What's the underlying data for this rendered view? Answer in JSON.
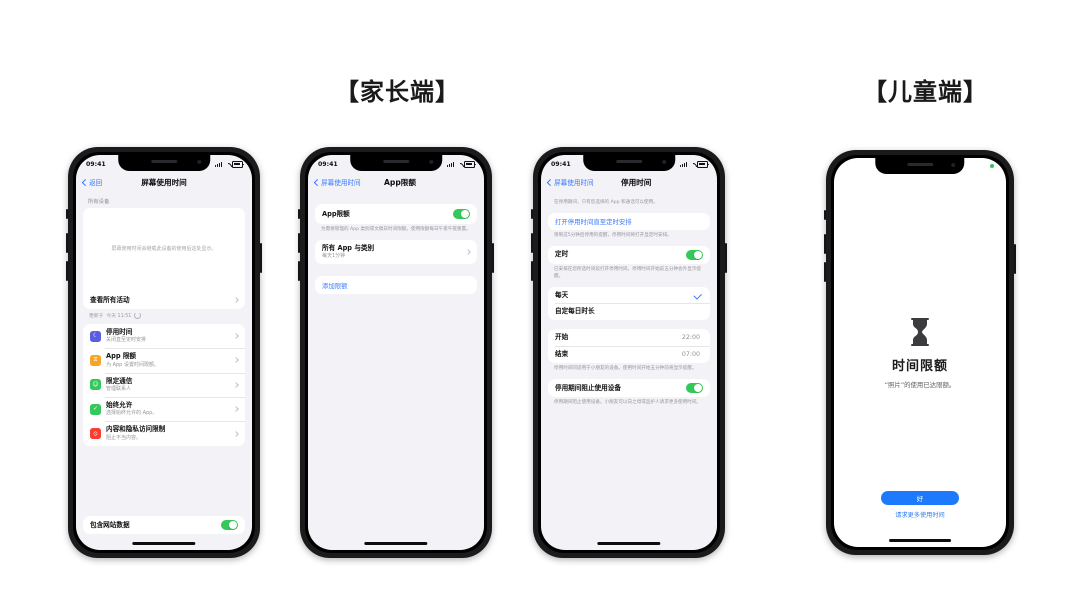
{
  "headings": {
    "parent": "【家长端】",
    "child": "【儿童端】"
  },
  "colors": {
    "accent_blue": "#3a7afe",
    "toggle_green": "#34c759",
    "primary_button": "#1d7afc",
    "screen_bg": "#f2f2f7",
    "icon_downtime": "#5c5ce0",
    "icon_app_limits": "#f5a623",
    "icon_communication": "#34c759",
    "icon_always_allowed": "#34c759",
    "icon_content_privacy": "#ff3b30"
  },
  "status_bar": {
    "time": "09:41",
    "signal_icon": "signal-bars-icon",
    "wifi_icon": "wifi-icon",
    "battery_icon": "battery-icon"
  },
  "phones": [
    {
      "id": "screen-time",
      "nav": {
        "back_label": "返回",
        "title": "屏幕使用时间",
        "back_icon": "chevron-left-icon"
      },
      "group_label": "所有设备",
      "chart": {
        "empty_text": "屏幕使用时间会继载此设备的使用后这处显示。",
        "all_activity_label": "查看所有活动",
        "updated_label": "更新于",
        "updated_value": "今天 11:51",
        "refresh_icon": "refresh-icon"
      },
      "items": [
        {
          "title": "停用时间",
          "sub": "关闭直至定时安排",
          "icon": "downtime-icon",
          "color": "#5c5ce0",
          "glyph": "☾"
        },
        {
          "title": "App 限额",
          "sub": "为 App 设置时间限额。",
          "icon": "app-limits-icon",
          "color": "#f5a623",
          "glyph": "⧖"
        },
        {
          "title": "限定通信",
          "sub": "管理联系人",
          "icon": "communication-limits-icon",
          "color": "#34c759",
          "glyph": "☺"
        },
        {
          "title": "始终允许",
          "sub": "选择始终允许的 App。",
          "icon": "always-allowed-icon",
          "color": "#34c759",
          "glyph": "✓"
        },
        {
          "title": "内容和隐私访问限制",
          "sub": "阻止不当内容。",
          "icon": "content-privacy-icon",
          "color": "#ff3b30",
          "glyph": "⦸"
        }
      ],
      "website_data": {
        "label": "包含网站数据",
        "toggle_on": true
      }
    },
    {
      "id": "app-limits",
      "nav": {
        "back_label": "屏幕使用时间",
        "title": "App限额",
        "back_icon": "chevron-left-icon"
      },
      "toggle_row": {
        "label": "App限额",
        "toggle_on": true
      },
      "toggle_footnote": "为需要管理的 App 类别或文稿日时间限额。使用限额每日午夜午夜重置。",
      "all_apps": {
        "title": "所有 App 与类别",
        "sub": "每天1分钟"
      },
      "add_limit_label": "添加限额"
    },
    {
      "id": "downtime",
      "nav": {
        "back_label": "屏幕使用时间",
        "title": "停用时间",
        "back_icon": "chevron-left-icon"
      },
      "intro": "在停用期间，只有您选择的 App 和通话可以使用。",
      "turn_on_label": "打开停用时间直至定时安排",
      "turn_on_footnote": "限制这5分钟后停用的提醒，停用时间将打开显定时安排。",
      "schedule_row": {
        "label": "定时",
        "toggle_on": true
      },
      "schedule_footnote": "已安排在您所选时间段打开停用时间。停用时间开始前五分钟会外显示提醒。",
      "mode_options": [
        {
          "label": "每天",
          "selected": true
        },
        {
          "label": "自定每日时长",
          "selected": false
        }
      ],
      "times": [
        {
          "label": "开始",
          "value": "22:00"
        },
        {
          "label": "结束",
          "value": "07:00"
        }
      ],
      "times_footnote": "停用时间同适用于小朋友的设备。使用时间开始五分钟前将显示提醒。",
      "block_row": {
        "label": "停用期间阻止使用设备",
        "toggle_on": true
      },
      "block_footnote": "停用期间阻止使用设备。小朋友可以向之母或监护人请求更多使用时间。"
    },
    {
      "id": "child-limit",
      "hourglass_icon": "hourglass-icon",
      "title": "时间限额",
      "subtitle": "“照片”的使用已达限额。",
      "ok_label": "好",
      "request_label": "请求更多使用时间",
      "indicator_icon": "green-dot-icon"
    }
  ]
}
